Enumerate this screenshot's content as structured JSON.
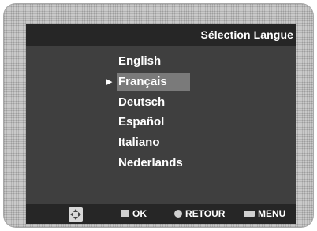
{
  "header": {
    "title": "Sélection Langue"
  },
  "menu": {
    "items": [
      {
        "label": "English",
        "selected": false
      },
      {
        "label": "Français",
        "selected": true
      },
      {
        "label": "Deutsch",
        "selected": false
      },
      {
        "label": "Español",
        "selected": false
      },
      {
        "label": "Italiano",
        "selected": false
      },
      {
        "label": "Nederlands",
        "selected": false
      }
    ],
    "cursor_glyph": "▶"
  },
  "footer": {
    "nav_icon": "directional-pad-icon",
    "ok": {
      "icon": "enter-icon",
      "label": "OK"
    },
    "retour": {
      "icon": "return-icon",
      "label": "RETOUR"
    },
    "menu": {
      "icon": "menu-icon",
      "label": "MENU"
    }
  },
  "colors": {
    "screen_bg": "#3f3f3f",
    "bar_bg": "#262626",
    "highlight": "#7a7a7a",
    "text": "#ffffff",
    "frame": "#c9c9c9"
  }
}
